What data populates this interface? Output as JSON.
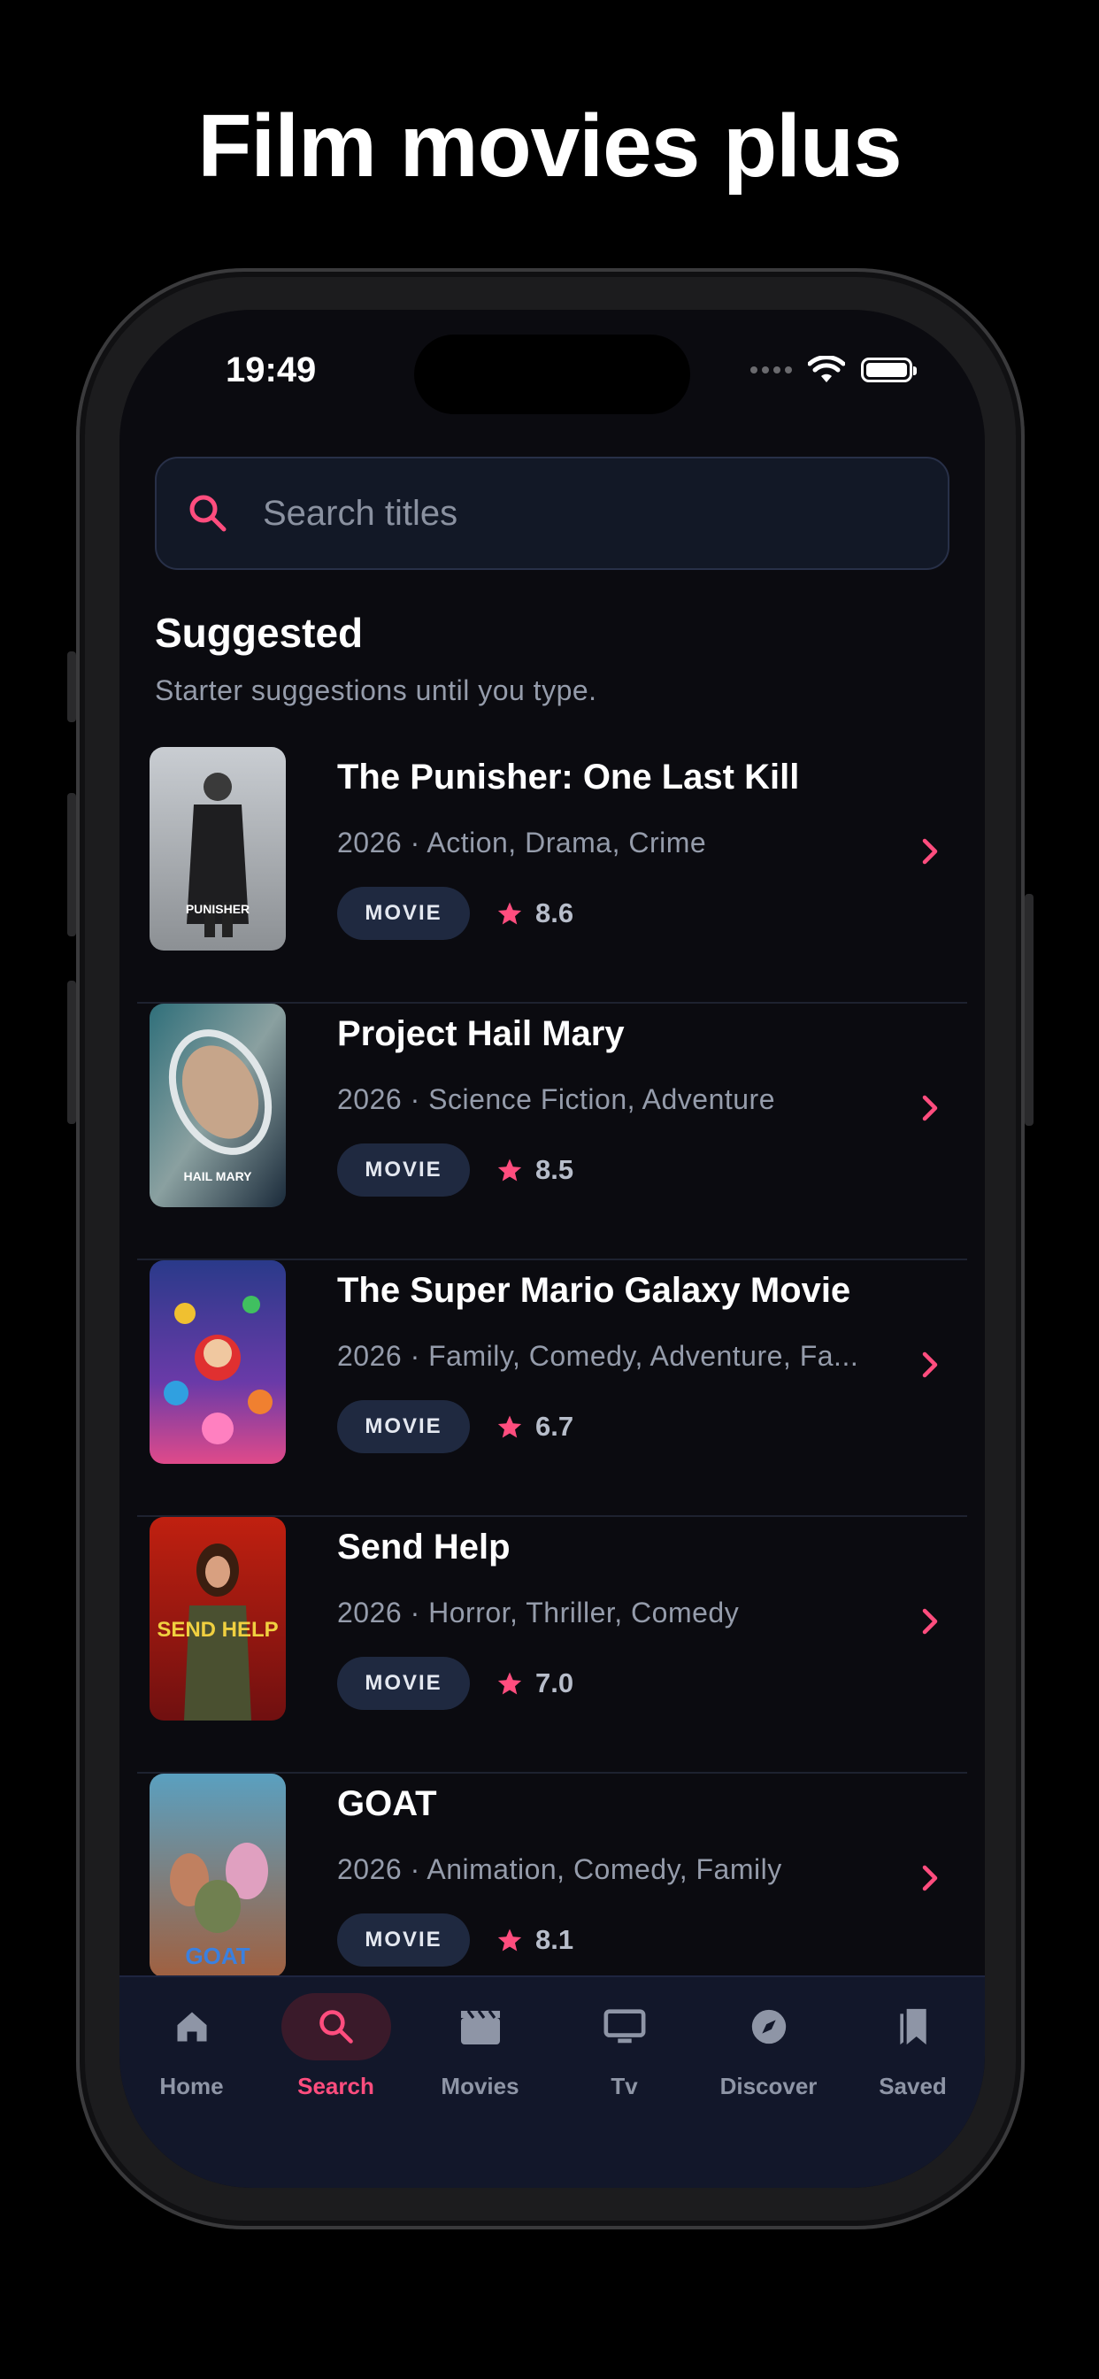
{
  "promo": {
    "title": "Film movies plus"
  },
  "status_bar": {
    "time": "19:49"
  },
  "search": {
    "placeholder": "Search titles",
    "value": ""
  },
  "section": {
    "title": "Suggested",
    "subtitle": "Starter suggestions until you type."
  },
  "colors": {
    "accent": "#ff4d7e",
    "background": "#0b0b10",
    "badge": "#1f2940"
  },
  "movies": [
    {
      "title": "The Punisher: One Last Kill",
      "meta": "2026 · Action, Drama, Crime",
      "type": "MOVIE",
      "rating": "8.6",
      "poster_text": "PUNISHER"
    },
    {
      "title": "Project Hail Mary",
      "meta": "2026 · Science Fiction, Adventure",
      "type": "MOVIE",
      "rating": "8.5",
      "poster_text": "HAIL MARY"
    },
    {
      "title": "The Super Mario Galaxy Movie",
      "meta": "2026 · Family, Comedy, Adventure, Fa...",
      "type": "MOVIE",
      "rating": "6.7",
      "poster_text": ""
    },
    {
      "title": "Send Help",
      "meta": "2026 · Horror, Thriller, Comedy",
      "type": "MOVIE",
      "rating": "7.0",
      "poster_text": "SEND HELP"
    },
    {
      "title": "GOAT",
      "meta": "2026 · Animation, Comedy, Family",
      "type": "MOVIE",
      "rating": "8.1",
      "poster_text": "GOAT"
    }
  ],
  "tabs": [
    {
      "label": "Home",
      "icon": "home-icon"
    },
    {
      "label": "Search",
      "icon": "search-icon",
      "active": true
    },
    {
      "label": "Movies",
      "icon": "clapperboard-icon"
    },
    {
      "label": "Tv",
      "icon": "tv-icon"
    },
    {
      "label": "Discover",
      "icon": "compass-icon"
    },
    {
      "label": "Saved",
      "icon": "bookmark-icon"
    }
  ]
}
